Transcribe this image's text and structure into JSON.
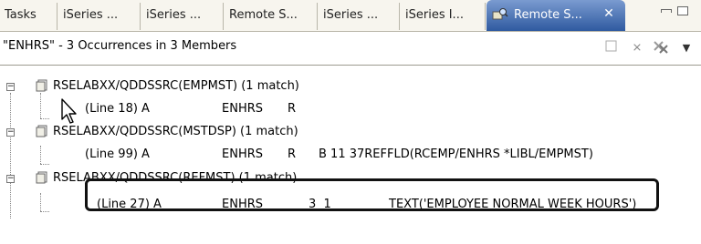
{
  "tabs": [
    {
      "label": "Tasks"
    },
    {
      "label": "iSeries ..."
    },
    {
      "label": "iSeries ..."
    },
    {
      "label": "Remote S..."
    },
    {
      "label": "iSeries ..."
    },
    {
      "label": "iSeries I..."
    },
    {
      "label": "Remote S...",
      "active": true
    }
  ],
  "header": {
    "title": "\"ENHRS\" - 3 Occurrences in 3 Members"
  },
  "results": [
    {
      "member": "RSELABXX/QDDSSRC(EMPMST) (1 match)",
      "line": {
        "location": "(Line 18) A",
        "field": "ENHRS",
        "spec": "R",
        "rest": ""
      }
    },
    {
      "member": "RSELABXX/QDDSSRC(MSTDSP) (1 match)",
      "line": {
        "location": "(Line 99) A",
        "field": "ENHRS",
        "spec": "R",
        "rest": "B 11 37REFFLD(RCEMP/ENHRS *LIBL/EMPMST)"
      }
    },
    {
      "member": "RSELABXX/QDDSSRC(REFMST) (1 match)",
      "line": {
        "location": "(Line 27) A",
        "field": "ENHRS",
        "spec": "3  1",
        "rest": "TEXT('EMPLOYEE NORMAL WEEK HOURS')"
      }
    }
  ],
  "colors": {
    "active_tab_top": "#7a9bd0",
    "active_tab_bottom": "#2f5aa0"
  }
}
